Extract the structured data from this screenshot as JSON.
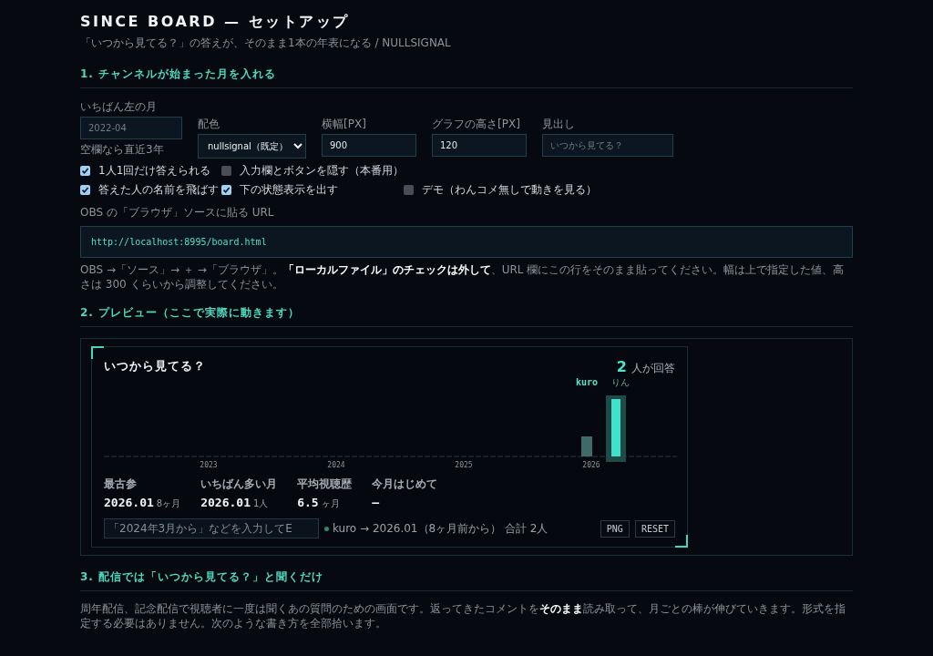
{
  "header": {
    "title": "SINCE BOARD — セットアップ",
    "subtitle": "「いつから見てる？」の答えが、そのまま1本の年表になる / NULLSIGNAL"
  },
  "section_1": {
    "heading": "1. チャンネルが始まった月を入れる",
    "fields": [
      {
        "kind": "input",
        "label": "いちばん左の月",
        "placeholder": "2022-04",
        "hint": "空欄なら直近3年"
      },
      {
        "kind": "select",
        "label": "配色",
        "value": "nullsignal（既定）"
      },
      {
        "kind": "input",
        "label": "横幅[PX]",
        "value": "900"
      },
      {
        "kind": "input",
        "label": "グラフの高さ[PX]",
        "value": "120"
      },
      {
        "kind": "input",
        "label": "見出し",
        "placeholder": "いつから見てる？"
      }
    ],
    "options": [
      {
        "label": "1人1回だけ答えられる",
        "checked": true
      },
      {
        "label": "入力欄とボタンを隠す（本番用）",
        "checked": false
      },
      {
        "label": "答えた人の名前を飛ばす",
        "checked": true
      },
      {
        "label": "下の状態表示を出す",
        "checked": true
      },
      {
        "label": "デモ（わんコメ無しで動きを見る）",
        "checked": false
      }
    ],
    "url_label": "OBS の「ブラウザ」ソースに貼る URL",
    "url": "http://localhost:8995/board.html",
    "note": "OBS →「ソース」→ ＋ →「ブラウザ」。**「ローカルファイル」のチェックは外して**、URL 欄にこの行をそのまま貼ってください。幅は上で指定した値、高さは 300 くらいから調整してください。"
  },
  "section_2": {
    "heading": "2. プレビュー（ここで実際に動きます）",
    "board": {
      "title": "いつから見てる？",
      "count": "2",
      "count_label": "人が回答",
      "year_labels": [
        "2023",
        "2024",
        "2025",
        "2026"
      ],
      "bars": [
        {
          "label": "kuro",
          "selected": false
        },
        {
          "label": "りん",
          "selected": true
        }
      ],
      "stats": [
        {
          "label": "最古参",
          "value": "2026.01",
          "unit": "8ヶ月"
        },
        {
          "label": "いちばん多い月",
          "value": "2026.01",
          "unit": "1人"
        },
        {
          "label": "平均視聴歴",
          "value": "6.5",
          "unit": "ヶ月"
        },
        {
          "label": "今月はじめて",
          "value": "—"
        }
      ],
      "input_placeholder": "「2024年3月から」などを入力してE",
      "status": "kuro → 2026.01（8ヶ月前から） 合計 2人",
      "buttons": [
        "PNG",
        "RESET"
      ]
    }
  },
  "section_3": {
    "heading": "3. 配信では「いつから見てる？」と聞くだけ",
    "body": "周年配信、記念配信で視聴者に一度は聞くあの質問のための画面です。返ってきたコメントを**そのまま**読み取って、月ごとの棒が伸びていきます。形式を指定する必要はありません。次のような書き方を全部拾います。"
  }
}
